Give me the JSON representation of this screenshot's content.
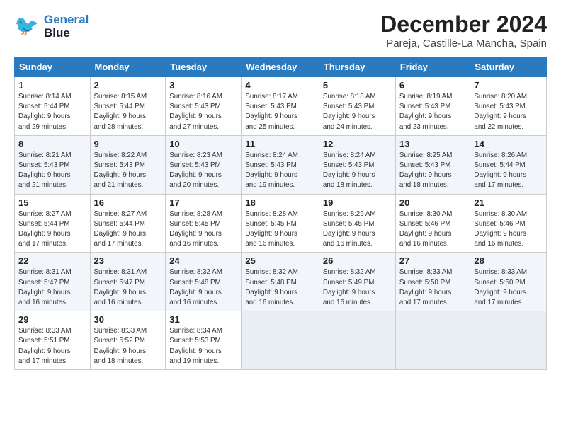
{
  "logo": {
    "line1": "General",
    "line2": "Blue"
  },
  "title": "December 2024",
  "location": "Pareja, Castille-La Mancha, Spain",
  "headers": [
    "Sunday",
    "Monday",
    "Tuesday",
    "Wednesday",
    "Thursday",
    "Friday",
    "Saturday"
  ],
  "weeks": [
    [
      {
        "num": "1",
        "info": "Sunrise: 8:14 AM\nSunset: 5:44 PM\nDaylight: 9 hours\nand 29 minutes."
      },
      {
        "num": "2",
        "info": "Sunrise: 8:15 AM\nSunset: 5:44 PM\nDaylight: 9 hours\nand 28 minutes."
      },
      {
        "num": "3",
        "info": "Sunrise: 8:16 AM\nSunset: 5:43 PM\nDaylight: 9 hours\nand 27 minutes."
      },
      {
        "num": "4",
        "info": "Sunrise: 8:17 AM\nSunset: 5:43 PM\nDaylight: 9 hours\nand 25 minutes."
      },
      {
        "num": "5",
        "info": "Sunrise: 8:18 AM\nSunset: 5:43 PM\nDaylight: 9 hours\nand 24 minutes."
      },
      {
        "num": "6",
        "info": "Sunrise: 8:19 AM\nSunset: 5:43 PM\nDaylight: 9 hours\nand 23 minutes."
      },
      {
        "num": "7",
        "info": "Sunrise: 8:20 AM\nSunset: 5:43 PM\nDaylight: 9 hours\nand 22 minutes."
      }
    ],
    [
      {
        "num": "8",
        "info": "Sunrise: 8:21 AM\nSunset: 5:43 PM\nDaylight: 9 hours\nand 21 minutes."
      },
      {
        "num": "9",
        "info": "Sunrise: 8:22 AM\nSunset: 5:43 PM\nDaylight: 9 hours\nand 21 minutes."
      },
      {
        "num": "10",
        "info": "Sunrise: 8:23 AM\nSunset: 5:43 PM\nDaylight: 9 hours\nand 20 minutes."
      },
      {
        "num": "11",
        "info": "Sunrise: 8:24 AM\nSunset: 5:43 PM\nDaylight: 9 hours\nand 19 minutes."
      },
      {
        "num": "12",
        "info": "Sunrise: 8:24 AM\nSunset: 5:43 PM\nDaylight: 9 hours\nand 18 minutes."
      },
      {
        "num": "13",
        "info": "Sunrise: 8:25 AM\nSunset: 5:43 PM\nDaylight: 9 hours\nand 18 minutes."
      },
      {
        "num": "14",
        "info": "Sunrise: 8:26 AM\nSunset: 5:44 PM\nDaylight: 9 hours\nand 17 minutes."
      }
    ],
    [
      {
        "num": "15",
        "info": "Sunrise: 8:27 AM\nSunset: 5:44 PM\nDaylight: 9 hours\nand 17 minutes."
      },
      {
        "num": "16",
        "info": "Sunrise: 8:27 AM\nSunset: 5:44 PM\nDaylight: 9 hours\nand 17 minutes."
      },
      {
        "num": "17",
        "info": "Sunrise: 8:28 AM\nSunset: 5:45 PM\nDaylight: 9 hours\nand 16 minutes."
      },
      {
        "num": "18",
        "info": "Sunrise: 8:28 AM\nSunset: 5:45 PM\nDaylight: 9 hours\nand 16 minutes."
      },
      {
        "num": "19",
        "info": "Sunrise: 8:29 AM\nSunset: 5:45 PM\nDaylight: 9 hours\nand 16 minutes."
      },
      {
        "num": "20",
        "info": "Sunrise: 8:30 AM\nSunset: 5:46 PM\nDaylight: 9 hours\nand 16 minutes."
      },
      {
        "num": "21",
        "info": "Sunrise: 8:30 AM\nSunset: 5:46 PM\nDaylight: 9 hours\nand 16 minutes."
      }
    ],
    [
      {
        "num": "22",
        "info": "Sunrise: 8:31 AM\nSunset: 5:47 PM\nDaylight: 9 hours\nand 16 minutes."
      },
      {
        "num": "23",
        "info": "Sunrise: 8:31 AM\nSunset: 5:47 PM\nDaylight: 9 hours\nand 16 minutes."
      },
      {
        "num": "24",
        "info": "Sunrise: 8:32 AM\nSunset: 5:48 PM\nDaylight: 9 hours\nand 16 minutes."
      },
      {
        "num": "25",
        "info": "Sunrise: 8:32 AM\nSunset: 5:48 PM\nDaylight: 9 hours\nand 16 minutes."
      },
      {
        "num": "26",
        "info": "Sunrise: 8:32 AM\nSunset: 5:49 PM\nDaylight: 9 hours\nand 16 minutes."
      },
      {
        "num": "27",
        "info": "Sunrise: 8:33 AM\nSunset: 5:50 PM\nDaylight: 9 hours\nand 17 minutes."
      },
      {
        "num": "28",
        "info": "Sunrise: 8:33 AM\nSunset: 5:50 PM\nDaylight: 9 hours\nand 17 minutes."
      }
    ],
    [
      {
        "num": "29",
        "info": "Sunrise: 8:33 AM\nSunset: 5:51 PM\nDaylight: 9 hours\nand 17 minutes."
      },
      {
        "num": "30",
        "info": "Sunrise: 8:33 AM\nSunset: 5:52 PM\nDaylight: 9 hours\nand 18 minutes."
      },
      {
        "num": "31",
        "info": "Sunrise: 8:34 AM\nSunset: 5:53 PM\nDaylight: 9 hours\nand 19 minutes."
      },
      null,
      null,
      null,
      null
    ]
  ]
}
